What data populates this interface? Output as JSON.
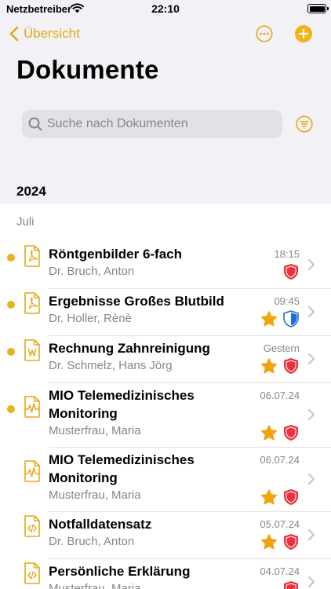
{
  "status_bar": {
    "carrier": "Netzbetreiber",
    "time": "22:10"
  },
  "nav": {
    "back_label": "Übersicht"
  },
  "page": {
    "title": "Dokumente"
  },
  "search": {
    "placeholder": "Suche nach Dokumenten"
  },
  "sections": [
    {
      "year": "2024",
      "month": "Juli",
      "documents": [
        {
          "title": "Röntgenbilder 6-fach",
          "sender": "Dr. Bruch, Anton",
          "time": "18:15",
          "icon": "pdf-document-icon",
          "unread": true,
          "starred": false,
          "shields": [
            "red"
          ]
        },
        {
          "title": "Ergebnisse Großes Blutbild",
          "sender": "Dr. Holler, Rènè",
          "time": "09:45",
          "icon": "pdf-document-icon",
          "unread": true,
          "starred": true,
          "shields": [
            "blue-half"
          ]
        },
        {
          "title": "Rechnung Zahnreinigung",
          "sender": "Dr. Schmelz, Hans Jörg",
          "time": "Gestern",
          "icon": "word-document-icon",
          "unread": true,
          "starred": true,
          "shields": [
            "red"
          ]
        },
        {
          "title": "MIO Telemedizinisches Monitoring",
          "sender": "Musterfrau, Maria",
          "time": "06.07.24",
          "icon": "monitoring-document-icon",
          "unread": true,
          "starred": true,
          "shields": [
            "red"
          ]
        },
        {
          "title": "MIO Telemedizinisches Monitoring",
          "sender": "Musterfrau, Maria",
          "time": "06.07.24",
          "icon": "monitoring-document-icon",
          "unread": false,
          "starred": true,
          "shields": [
            "red"
          ]
        },
        {
          "title": "Notfalldatensatz",
          "sender": "Dr. Bruch, Anton",
          "time": "05.07.24",
          "icon": "code-document-icon",
          "unread": false,
          "starred": true,
          "shields": [
            "red"
          ]
        },
        {
          "title": "Persönliche Erklärung",
          "sender": "Musterfrau, Maria",
          "time": "04.07.24",
          "icon": "code-document-icon",
          "unread": false,
          "starred": false,
          "shields": [
            "red"
          ]
        }
      ]
    }
  ],
  "colors": {
    "accent": "#e6a817",
    "unread_dot": "#e6b419",
    "star": "#f0a30a",
    "shield_red": "#e8323c",
    "shield_blue": "#1f6fd1",
    "secondary_text": "#86868c"
  }
}
